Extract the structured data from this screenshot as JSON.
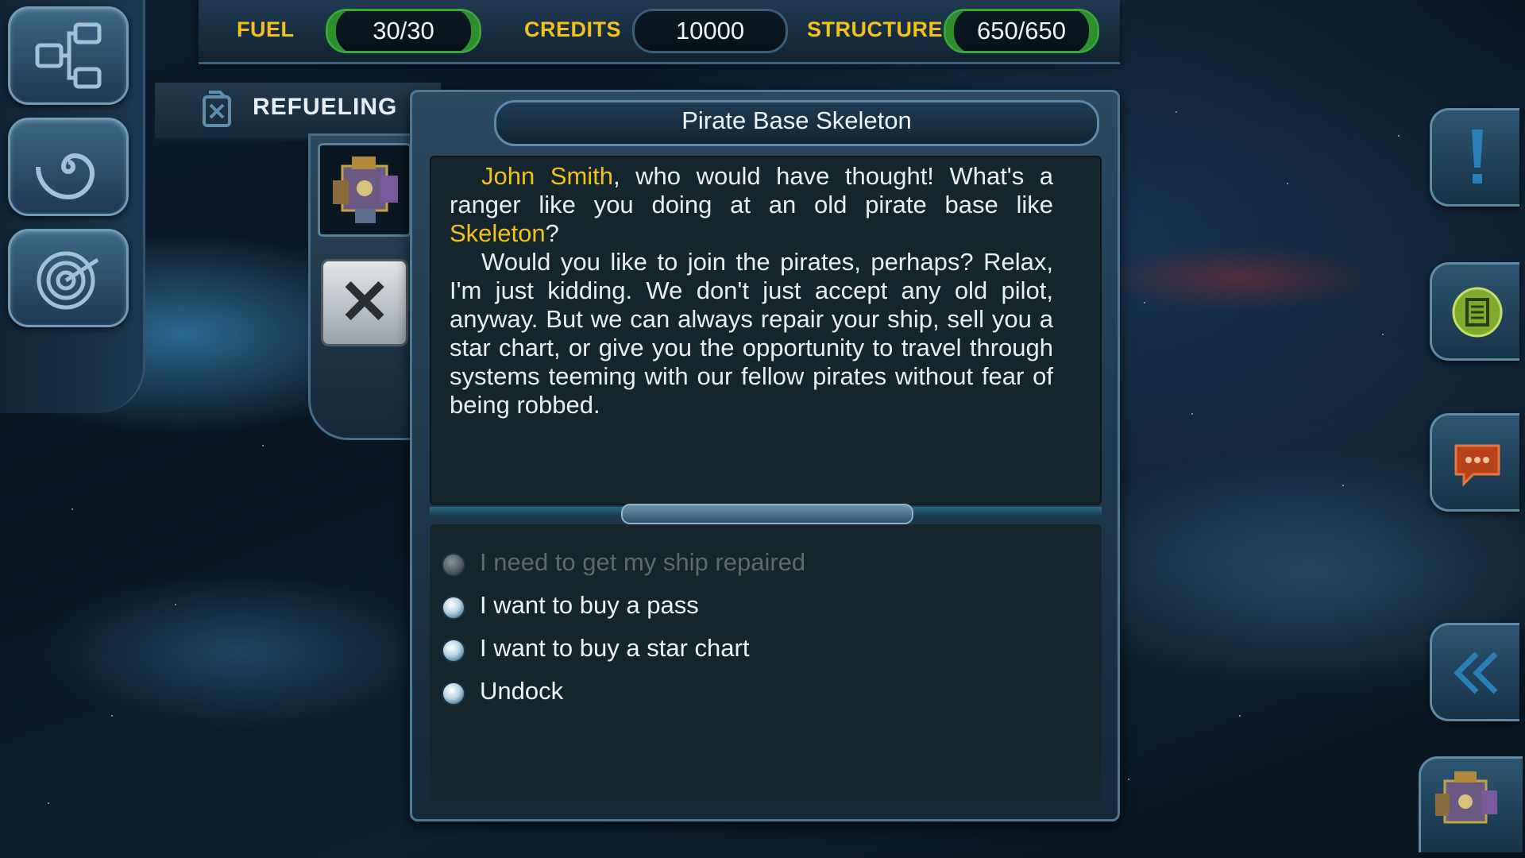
{
  "hud": {
    "fuel_label": "FUEL",
    "fuel_value": "30/30",
    "credits_label": "CREDITS",
    "credits_value": "10000",
    "structure_label": "STRUCTURE",
    "structure_value": "650/650"
  },
  "left_panel": {
    "refuel_label": "REFUELING",
    "buttons": [
      "network-map-icon",
      "galaxy-spiral-icon",
      "radar-icon"
    ]
  },
  "dialog": {
    "title": "Pirate Base Skeleton",
    "paragraph1": {
      "name": "John Smith",
      "text_a": ", who would have thought! What's a ranger like you doing at an old pirate base like ",
      "base": "Skeleton",
      "text_b": "?"
    },
    "paragraph2": "Would you like to join the pirates, perhaps? Relax, I'm just kidding. We don't just accept any old pilot, anyway. But we can always repair your ship, sell you a star chart, or give you the opportunity to travel through systems teeming with our fellow pirates without fear of being robbed.",
    "options": [
      {
        "label": "I need to get my ship repaired",
        "enabled": false
      },
      {
        "label": "I want to buy a pass",
        "enabled": true
      },
      {
        "label": "I want to buy a star chart",
        "enabled": true
      },
      {
        "label": "Undock",
        "enabled": true
      }
    ]
  },
  "right_panel": {
    "buttons": [
      "alert-icon",
      "notes-icon",
      "chat-icon",
      "back-arrows-icon"
    ]
  },
  "colors": {
    "highlight": "#f2c21b",
    "text": "#e9eef1",
    "disabled_text": "#5f6a6e",
    "panel_border": "#4a7896",
    "pill_green": "#38a83a"
  }
}
